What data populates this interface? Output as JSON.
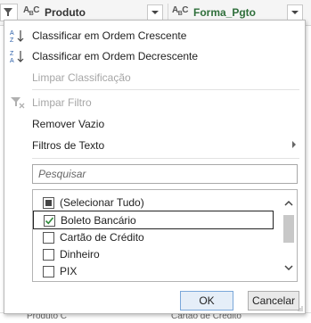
{
  "header": {
    "columns": [
      {
        "type_icon": "ABC",
        "name": "Produto"
      },
      {
        "type_icon": "ABC",
        "name": "Forma_Pgto"
      }
    ]
  },
  "menu": {
    "sort_asc": "Classificar em Ordem Crescente",
    "sort_desc": "Classificar em Ordem Decrescente",
    "clear_sort": "Limpar Classificação",
    "clear_filter": "Limpar Filtro",
    "remove_empty": "Remover Vazio",
    "text_filters": "Filtros de Texto"
  },
  "search": {
    "placeholder": "Pesquisar"
  },
  "list": {
    "items": [
      {
        "label": "(Selecionar Tudo)",
        "state": "partial"
      },
      {
        "label": "Boleto Bancário",
        "state": "checked"
      },
      {
        "label": "Cartão de Crédito",
        "state": "unchecked"
      },
      {
        "label": "Dinheiro",
        "state": "unchecked"
      },
      {
        "label": "PIX",
        "state": "unchecked"
      }
    ]
  },
  "buttons": {
    "ok": "OK",
    "cancel": "Cancelar"
  },
  "background_rows": {
    "produto": "Produto C",
    "forma": "Cartão de Crédito"
  },
  "colors": {
    "accent": "#2f6f3b",
    "ok_border": "#7aa7d9"
  }
}
